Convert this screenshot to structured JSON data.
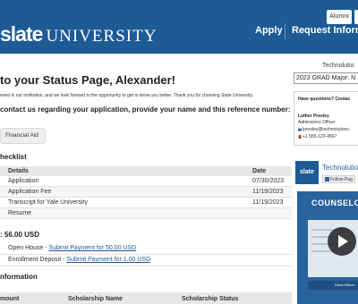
{
  "header": {
    "brand_bold": "slate",
    "brand_rest": "UNIVERSITY",
    "top_buttons": [
      "Alumni",
      ""
    ],
    "apply_label": "Apply",
    "request_label": "Request Informa"
  },
  "main": {
    "title": "to your Status Page, Alexander!",
    "intro": "erest in our institution, and we look forward to the opportunity to get to know you better. Thank you for choosing State University.",
    "reference": "contact us regarding your application, provide your name and this reference number:",
    "tab_label": "Financial Aid",
    "checklist_heading": "hecklist",
    "checklist_columns": [
      "Details",
      "Date"
    ],
    "checklist_rows": [
      {
        "detail": "Application",
        "date": "07/30/2023"
      },
      {
        "detail": "Application Fee",
        "date": "11/19/2023"
      },
      {
        "detail": "Transcript for Yale University",
        "date": "11/19/2023"
      },
      {
        "detail": "Resume",
        "date": ""
      }
    ],
    "balance": ": 56.00 USD",
    "payments": [
      {
        "label": "Open House - ",
        "link": "Submit Payment for 50.00 USD"
      },
      {
        "label": "Enrollment Deposit - ",
        "link": "Submit Payment for 1.00 USD"
      }
    ],
    "financial_heading": "nformation",
    "financial_columns": [
      "mount",
      "Scholarship Name",
      "Scholarship Status"
    ]
  },
  "sidebar": {
    "org_label": "Technolutio",
    "program_select": "2023 GRAD Major: N",
    "contact": {
      "question": "Have questions?  Contac",
      "name": "Luther Presley",
      "title": "Admissions Officer",
      "email": "lpresley@technolutions.",
      "phone": "+1 555-123-4567"
    },
    "widget": {
      "logo_text": "slate",
      "name": "Technolutio",
      "follow_label": "Follow Pag"
    },
    "video": {
      "title": "COUNSELOR TES",
      "badge": "Dana Wilson"
    }
  },
  "colors": {
    "header_blue": "#1d5a96",
    "link_blue": "#1d5a96",
    "table_header": "#e6e7e8",
    "video_blue": "#29639d",
    "facebook": "#3b5998"
  },
  "icons": {
    "email": "envelope-icon",
    "phone": "phone-icon",
    "play": "play-icon",
    "facebook": "facebook-icon"
  }
}
